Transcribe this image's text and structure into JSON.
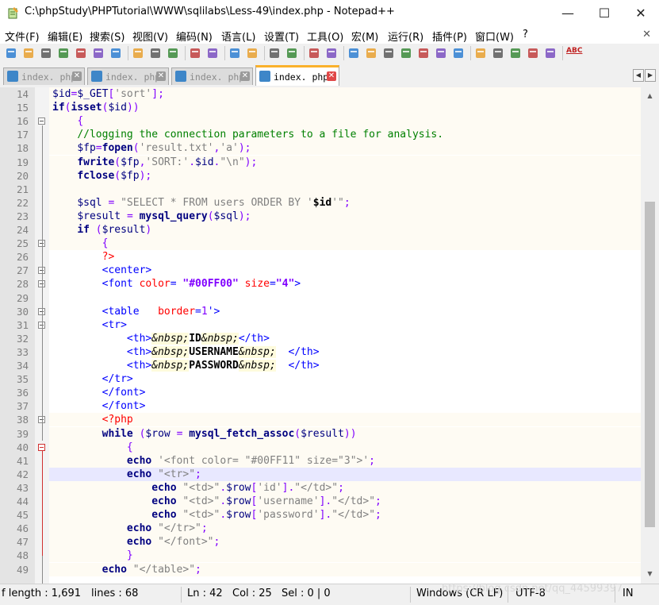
{
  "window": {
    "title": "C:\\phpStudy\\PHPTutorial\\WWW\\sqlilabs\\Less-49\\index.php - Notepad++",
    "minimize": "—",
    "maximize": "☐",
    "close": "✕"
  },
  "menu": {
    "items": [
      "文件(F)",
      "编辑(E)",
      "搜索(S)",
      "视图(V)",
      "编码(N)",
      "语言(L)",
      "设置(T)",
      "工具(O)",
      "宏(M)",
      "运行(R)",
      "插件(P)",
      "窗口(W)",
      "?"
    ],
    "close_glyph": "✕"
  },
  "toolbar": {
    "icons": [
      "new-file-icon",
      "open-file-icon",
      "save-icon",
      "save-all-icon",
      "close-icon",
      "close-all-icon",
      "print-icon",
      "cut-icon",
      "copy-icon",
      "paste-icon",
      "undo-icon",
      "redo-icon",
      "find-icon",
      "replace-icon",
      "zoom-in-icon",
      "zoom-out-icon",
      "sync-vertical-icon",
      "sync-horizontal-icon",
      "word-wrap-icon",
      "show-all-chars-icon",
      "indent-guide-icon",
      "doc-map-icon",
      "function-list-icon",
      "folder-workspace-icon",
      "monitor-icon",
      "record-macro-icon",
      "stop-macro-icon",
      "play-macro-icon",
      "run-macro-multiple-icon",
      "save-macro-icon",
      "spell-check-icon"
    ],
    "spell_label": "ABC"
  },
  "tabs": [
    {
      "label": "index. php",
      "active": false
    },
    {
      "label": "index. php",
      "active": false
    },
    {
      "label": "index. php",
      "active": false
    },
    {
      "label": "index. php",
      "active": true
    }
  ],
  "tab_close_glyph": "✕",
  "tab_arrows": [
    "◀",
    "▶"
  ],
  "editor": {
    "current_line": 42,
    "lines": [
      {
        "n": "14",
        "html": "<span class=\"var\">$id</span><span class=\"op\">=</span><span class=\"var\">$_GET</span><span class=\"op\">[</span><span class=\"str\">'sort'</span><span class=\"op\">];</span>"
      },
      {
        "n": "15",
        "html": "<span class=\"kw\">if</span><span class=\"op\">(</span><span class=\"kw\">isset</span><span class=\"op\">(</span><span class=\"var\">$id</span><span class=\"op\">))</span>"
      },
      {
        "n": "16",
        "html": "    <span class=\"op\">{</span>"
      },
      {
        "n": "17",
        "html": "    <span class=\"cmt\">//logging the connection parameters to a file for analysis.</span>"
      },
      {
        "n": "18",
        "html": "    <span class=\"var\">$fp</span><span class=\"op\">=</span><span class=\"kw\">fopen</span><span class=\"op\">(</span><span class=\"str\">'result.txt'</span><span class=\"op\">,</span><span class=\"str\">'a'</span><span class=\"op\">);</span>"
      },
      {
        "n": "19",
        "html": "    <span class=\"kw\">fwrite</span><span class=\"op\">(</span><span class=\"var\">$fp</span><span class=\"op\">,</span><span class=\"str\">'SORT:'</span><span class=\"op\">.</span><span class=\"var\">$id</span><span class=\"op\">.</span><span class=\"dq\">\"\\n\"</span><span class=\"op\">);</span>"
      },
      {
        "n": "20",
        "html": "    <span class=\"kw\">fclose</span><span class=\"op\">(</span><span class=\"var\">$fp</span><span class=\"op\">);</span>"
      },
      {
        "n": "21",
        "html": ""
      },
      {
        "n": "22",
        "html": "    <span class=\"var\">$sql</span> <span class=\"op\">=</span> <span class=\"dq\">\"SELECT * FROM users ORDER BY '<span class=\"bold\" style=\"color:#000\">$id</span>'\"</span><span class=\"op\">;</span>"
      },
      {
        "n": "23",
        "html": "    <span class=\"var\">$result</span> <span class=\"op\">=</span> <span class=\"kw\">mysql_query</span><span class=\"op\">(</span><span class=\"var\">$sql</span><span class=\"op\">);</span>"
      },
      {
        "n": "24",
        "html": "    <span class=\"kw\">if</span> <span class=\"op\">(</span><span class=\"var\">$result</span><span class=\"op\">)</span>"
      },
      {
        "n": "25",
        "html": "        <span class=\"op\">{</span>"
      },
      {
        "n": "26",
        "html": "        <span class=\"php\">?&gt;</span>"
      },
      {
        "n": "27",
        "html": "        <span class=\"tag\">&lt;center&gt;</span>"
      },
      {
        "n": "28",
        "html": "        <span class=\"tag\">&lt;font</span> <span class=\"attr\">color</span><span class=\"tag\">=</span> <span class=\"aval\">\"#00FF00\"</span> <span class=\"attr\">size</span><span class=\"tag\">=</span><span class=\"aval\">\"4\"</span><span class=\"tag\">&gt;</span>"
      },
      {
        "n": "29",
        "html": ""
      },
      {
        "n": "30",
        "html": "        <span class=\"tag\">&lt;table</span>   <span class=\"attr\">border</span><span class=\"tag\">=</span><span class=\"aval\" style=\"font-weight:normal\">1</span><span class=\"tag\">'&gt;</span>"
      },
      {
        "n": "31",
        "html": "        <span class=\"tag\">&lt;tr&gt;</span>"
      },
      {
        "n": "32",
        "html": "            <span class=\"tag\">&lt;th&gt;</span><span class=\"ent\">&amp;nbsp;</span><span class=\"bold\">ID</span><span class=\"ent\">&amp;nbsp;</span><span class=\"tag\">&lt;/th&gt;</span>"
      },
      {
        "n": "33",
        "html": "            <span class=\"tag\">&lt;th&gt;</span><span class=\"ent\">&amp;nbsp;</span><span class=\"bold\">USERNAME</span><span class=\"ent\">&amp;nbsp;</span>  <span class=\"tag\">&lt;/th&gt;</span>"
      },
      {
        "n": "34",
        "html": "            <span class=\"tag\">&lt;th&gt;</span><span class=\"ent\">&amp;nbsp;</span><span class=\"bold\">PASSWORD</span><span class=\"ent\">&amp;nbsp;</span>  <span class=\"tag\">&lt;/th&gt;</span>"
      },
      {
        "n": "35",
        "html": "        <span class=\"tag\">&lt;/tr&gt;</span>"
      },
      {
        "n": "36",
        "html": "        <span class=\"tag\">&lt;/font&gt;</span>"
      },
      {
        "n": "37",
        "html": "        <span class=\"tag\">&lt;/font&gt;</span>"
      },
      {
        "n": "38",
        "html": "        <span class=\"php\">&lt;?php</span>"
      },
      {
        "n": "39",
        "html": "        <span class=\"kw\">while</span> <span class=\"op\">(</span><span class=\"var\">$row</span> <span class=\"op\">=</span> <span class=\"kw\">mysql_fetch_assoc</span><span class=\"op\">(</span><span class=\"var\">$result</span><span class=\"op\">))</span>"
      },
      {
        "n": "40",
        "html": "            <span class=\"op\">{</span>"
      },
      {
        "n": "41",
        "html": "            <span class=\"kw\">echo</span> <span class=\"str\">'&lt;font color= \"#00FF11\" size=\"3\"&gt;'</span><span class=\"op\">;</span>"
      },
      {
        "n": "42",
        "html": "            <span class=\"kw\">echo</span> <span class=\"dq\">\"&lt;tr&gt;\"</span><span class=\"op\">;</span>"
      },
      {
        "n": "43",
        "html": "                <span class=\"kw\">echo</span> <span class=\"dq\">\"&lt;td&gt;\"</span><span class=\"op\">.</span><span class=\"var\">$row</span><span class=\"op\">[</span><span class=\"str\">'id'</span><span class=\"op\">].</span><span class=\"dq\">\"&lt;/td&gt;\"</span><span class=\"op\">;</span>"
      },
      {
        "n": "44",
        "html": "                <span class=\"kw\">echo</span> <span class=\"dq\">\"&lt;td&gt;\"</span><span class=\"op\">.</span><span class=\"var\">$row</span><span class=\"op\">[</span><span class=\"str\">'username'</span><span class=\"op\">].</span><span class=\"dq\">\"&lt;/td&gt;\"</span><span class=\"op\">;</span>"
      },
      {
        "n": "45",
        "html": "                <span class=\"kw\">echo</span> <span class=\"dq\">\"&lt;td&gt;\"</span><span class=\"op\">.</span><span class=\"var\">$row</span><span class=\"op\">[</span><span class=\"str\">'password'</span><span class=\"op\">].</span><span class=\"dq\">\"&lt;/td&gt;\"</span><span class=\"op\">;</span>"
      },
      {
        "n": "46",
        "html": "            <span class=\"kw\">echo</span> <span class=\"dq\">\"&lt;/tr&gt;\"</span><span class=\"op\">;</span>"
      },
      {
        "n": "47",
        "html": "            <span class=\"kw\">echo</span> <span class=\"dq\">\"&lt;/font&gt;\"</span><span class=\"op\">;</span>"
      },
      {
        "n": "48",
        "html": "            <span class=\"op\">}</span>"
      },
      {
        "n": "49",
        "html": "        <span class=\"kw\">echo</span> <span class=\"dq\">\"&lt;/table&gt;\"</span><span class=\"op\">;</span>"
      }
    ]
  },
  "scroll_arrows": [
    "▲",
    "▼"
  ],
  "status": {
    "length": "f length : 1,691",
    "lines": "lines : 68",
    "ln": "Ln : 42",
    "col": "Col : 25",
    "sel": "Sel : 0 | 0",
    "eol": "Windows (CR LF)",
    "encoding": "UTF-8",
    "mode": "IN",
    "watermark": "https://blog.csdn.net/qq_44599397"
  },
  "colors": {
    "keyword": "#000080",
    "comment": "#008000",
    "string": "#808080",
    "operator": "#8000ff",
    "tag": "#0000ff",
    "attribute": "#ff0000",
    "current_line": "#e8e8ff",
    "active_tab_accent": "#fab12b"
  }
}
